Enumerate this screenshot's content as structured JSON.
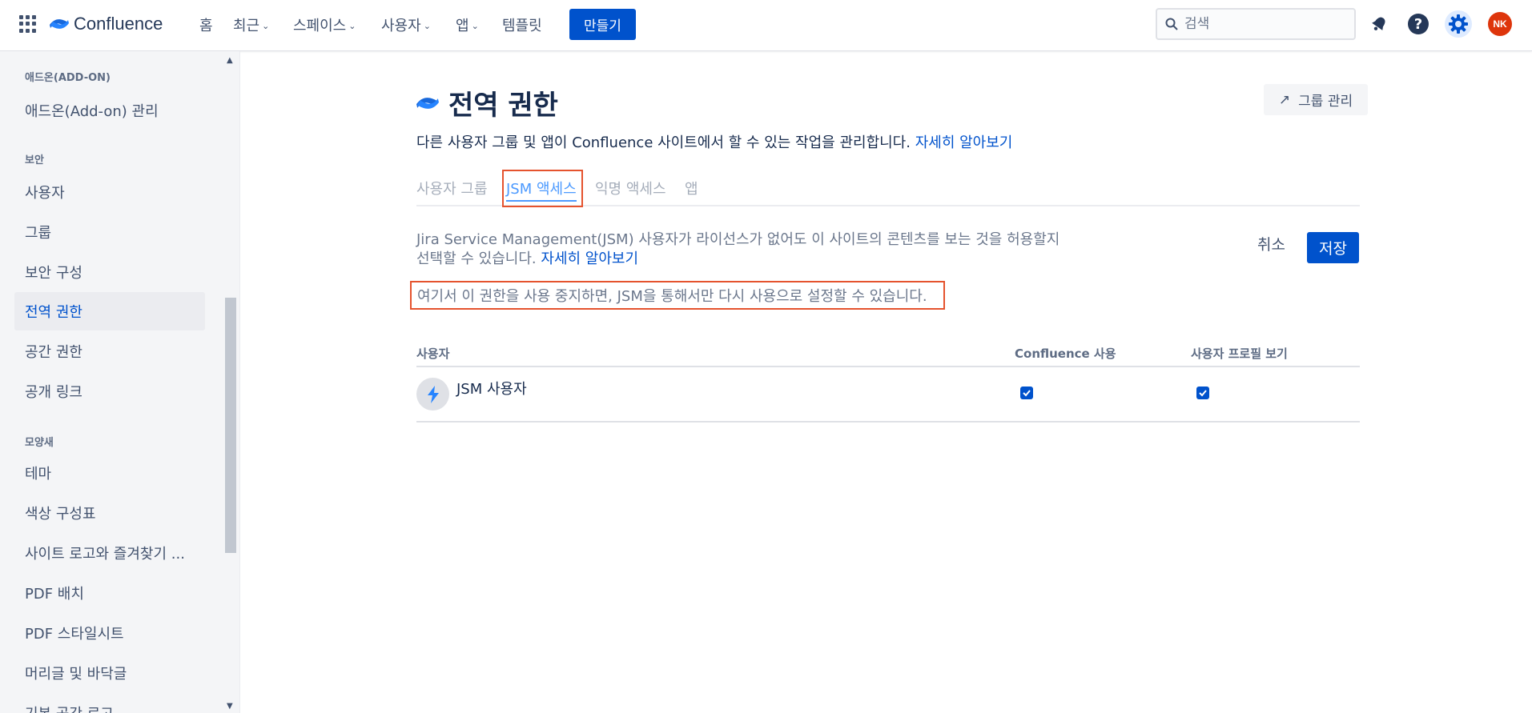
{
  "topnav": {
    "logo_text": "Confluence",
    "items": [
      {
        "label": "홈"
      },
      {
        "label": "최근"
      },
      {
        "label": "스페이스"
      },
      {
        "label": "사용자"
      },
      {
        "label": "앱"
      },
      {
        "label": "템플릿"
      }
    ],
    "create_label": "만들기",
    "search_placeholder": "검색",
    "avatar_initials": "NK",
    "brand_color": "#0052cc",
    "avatar_color": "#de350b"
  },
  "sidebar": {
    "sections": [
      {
        "title": "애드온(ADD-ON)",
        "items": [
          "애드온(Add-on) 관리"
        ]
      },
      {
        "title": "보안",
        "items": [
          "사용자",
          "그룹",
          "보안 구성",
          "전역 권한",
          "공간 권한",
          "공개 링크"
        ]
      },
      {
        "title": "모양새",
        "items": [
          "테마",
          "색상 구성표",
          "사이트 로고와 즐겨찾기 ...",
          "PDF 배치",
          "PDF 스타일시트",
          "머리글 및 바닥글",
          "기본 공간 로고"
        ]
      }
    ],
    "active_item": "전역 권한"
  },
  "main": {
    "title": "전역 권한",
    "manage_groups_label": "그룹 관리",
    "description": "다른 사용자 그룹 및 앱이 Confluence 사이트에서 할 수 있는 작업을 관리합니다.",
    "learn_more": "자세히 알아보기",
    "tabs": [
      {
        "label": "사용자 그룹"
      },
      {
        "label": "JSM 액세스"
      },
      {
        "label": "익명 액세스"
      },
      {
        "label": "앱"
      }
    ],
    "active_tab": "JSM 액세스",
    "jsm_description": "Jira Service Management(JSM) 사용자가 라이선스가 없어도 이 사이트의 콘텐츠를 보는 것을 허용할지 선택할 수 있습니다.",
    "jsm_learn_more": "자세히 알아보기",
    "cancel_label": "취소",
    "save_label": "저장",
    "warning": "여기서 이 권한을 사용 중지하면, JSM을 통해서만 다시 사용으로 설정할 수 있습니다.",
    "table": {
      "columns": [
        "사용자",
        "Confluence 사용",
        "사용자 프로필 보기"
      ],
      "rows": [
        {
          "name": "JSM 사용자",
          "confluence_use": true,
          "view_profile": true
        }
      ]
    },
    "highlight_color": "#e5532e"
  }
}
